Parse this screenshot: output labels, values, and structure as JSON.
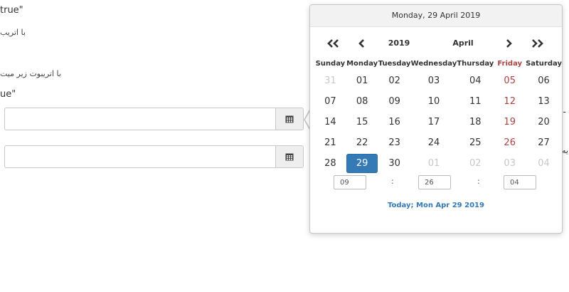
{
  "background": {
    "text1": "true\"",
    "text2": "با اتریب",
    "text3": "با اتریبوت زیر میت",
    "text4": "ue\"",
    "edge1": "ـ",
    "edge2": "يه"
  },
  "inputs": [
    {
      "value": "",
      "icon": "calendar-icon"
    },
    {
      "value": "",
      "icon": "calendar-icon"
    }
  ],
  "picker": {
    "header": "Monday, 29 April 2019",
    "year": "2019",
    "month": "April",
    "weekdays": [
      "Sunday",
      "Monday",
      "Tuesday",
      "Wednesday",
      "Thursday",
      "Friday",
      "Saturday"
    ],
    "weeks": [
      [
        "31",
        "01",
        "02",
        "03",
        "04",
        "05",
        "06"
      ],
      [
        "07",
        "08",
        "09",
        "10",
        "11",
        "12",
        "13"
      ],
      [
        "14",
        "15",
        "16",
        "17",
        "18",
        "19",
        "20"
      ],
      [
        "21",
        "22",
        "23",
        "24",
        "25",
        "26",
        "27"
      ],
      [
        "28",
        "29",
        "30",
        "01",
        "02",
        "03",
        "04"
      ]
    ],
    "time": {
      "hour": "09",
      "minute": "26",
      "second": "04",
      "separator": ":"
    },
    "today_label": "Today; Mon Apr 29 2019",
    "colors": {
      "selected": "#337ab7",
      "friday": "#a94442",
      "muted": "#c8c8c8",
      "link": "#337ab7"
    }
  }
}
